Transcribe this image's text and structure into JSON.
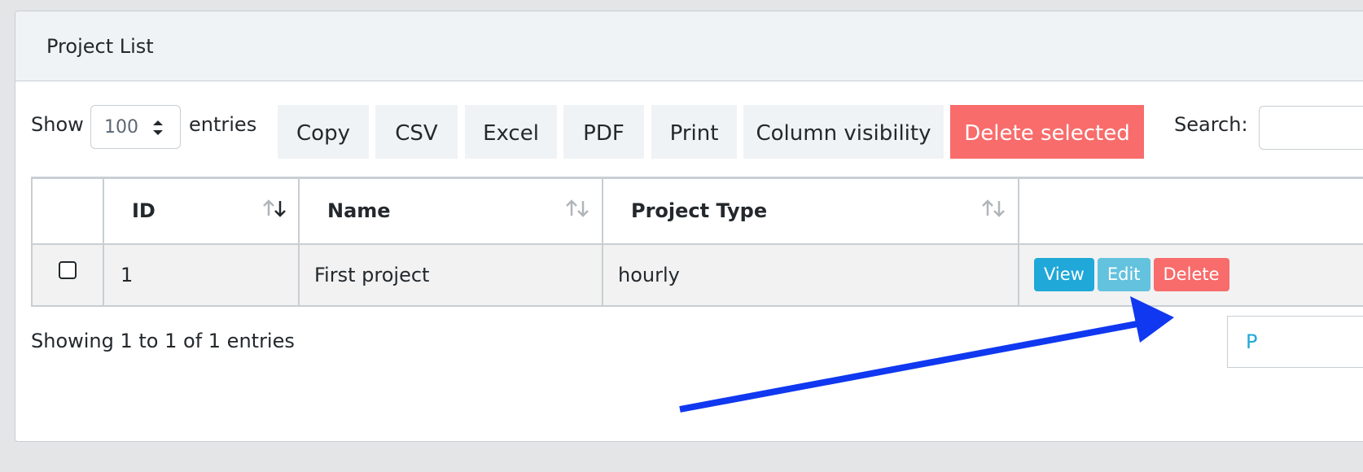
{
  "card": {
    "title": "Project List"
  },
  "toolbar": {
    "show_label": "Show",
    "length_value": "100",
    "entries_label": "entries",
    "buttons": {
      "copy": "Copy",
      "csv": "CSV",
      "excel": "Excel",
      "pdf": "PDF",
      "print": "Print",
      "colvis": "Column visibility",
      "delete_selected": "Delete selected"
    },
    "search_label": "Search:"
  },
  "table": {
    "headers": {
      "id": "ID",
      "name": "Name",
      "type": "Project Type"
    },
    "rows": [
      {
        "id": "1",
        "name": "First project",
        "type": "hourly",
        "actions": {
          "view": "View",
          "edit": "Edit",
          "delete": "Delete"
        }
      }
    ]
  },
  "footer": {
    "info": "Showing 1 to 1 of 1 entries",
    "pager_partial": "P"
  },
  "colors": {
    "danger": "#f86c6b",
    "info": "#20a8d8",
    "info_light": "#63c2de",
    "annotation_arrow": "#1038f0"
  }
}
